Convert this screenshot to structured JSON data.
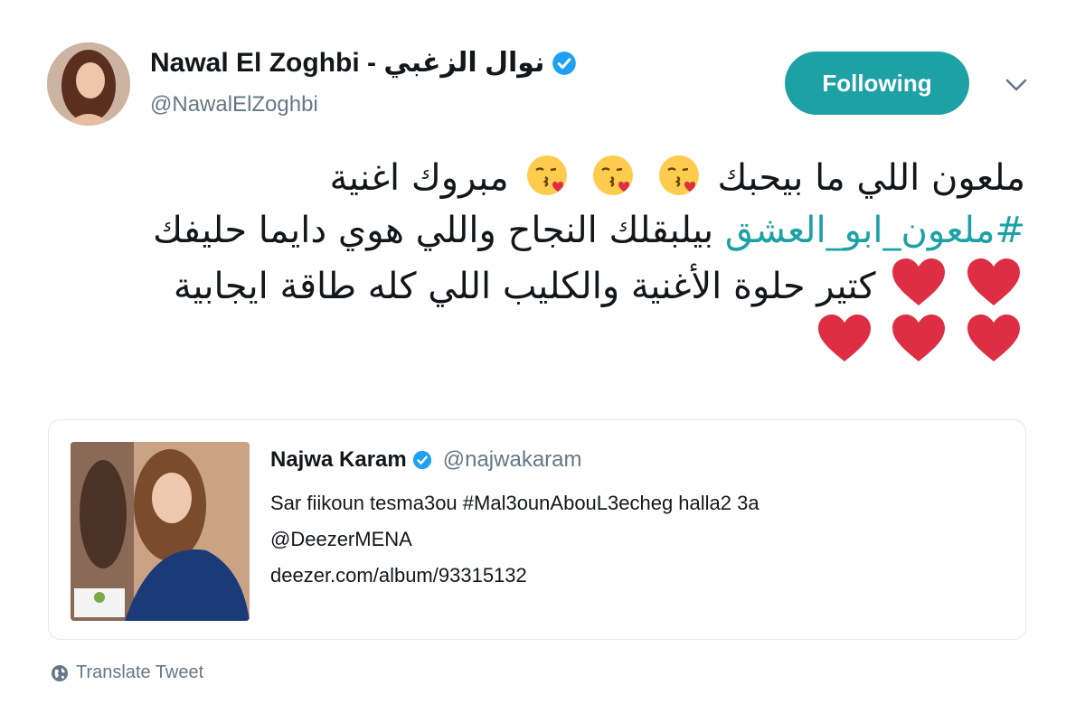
{
  "author": {
    "display_name": "Nawal El Zoghbi - نوال الزغبي",
    "handle": "@NawalElZoghbi",
    "verified_icon": "verified-badge-icon"
  },
  "follow_button": {
    "label": "Following"
  },
  "tweet": {
    "line1": "ملعون اللي ما بيحبك",
    "line1_end": "مبروك اغنية",
    "hashtag": "#ملعون_ابو_العشق",
    "line2_rest": "بيلبقلك النجاح واللي هوي دايما حليفك",
    "line3": "كتير حلوة الأغنية والكليب اللي كله طاقة ايجابية"
  },
  "quoted_tweet": {
    "name": "Najwa Karam",
    "handle": "@najwakaram",
    "text_line1": "Sar fiikoun tesma3ou #Mal3ounAbouL3echeg halla2 3a",
    "text_line2": "@DeezerMENA",
    "text_line3": "deezer.com/album/93315132"
  },
  "translate": {
    "label": "Translate Tweet"
  },
  "colors": {
    "accent": "#1da1a5",
    "muted": "#657786",
    "heart": "#e0245e",
    "verified": "#1da1f2"
  }
}
